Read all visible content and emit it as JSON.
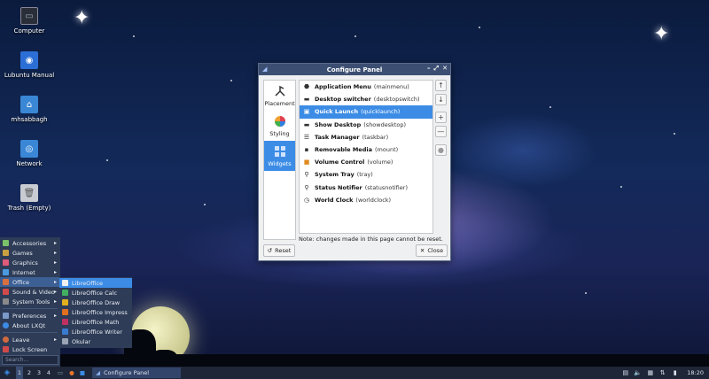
{
  "desktop_icons": [
    {
      "label": "Computer",
      "icon": "computer-icon"
    },
    {
      "label": "Lubuntu Manual",
      "icon": "manual-icon"
    },
    {
      "label": "mhsabbagh",
      "icon": "home-folder-icon"
    },
    {
      "label": "Network",
      "icon": "network-icon"
    },
    {
      "label": "Trash (Empty)",
      "icon": "trash-icon"
    }
  ],
  "dialog": {
    "title": "Configure Panel",
    "sidebar": [
      {
        "label": "Placement",
        "icon": "placement-icon"
      },
      {
        "label": "Styling",
        "icon": "styling-icon"
      },
      {
        "label": "Widgets",
        "icon": "widgets-icon"
      }
    ],
    "widgets": [
      {
        "name": "Application Menu",
        "id": "(mainmenu)",
        "icon": "menu-icon"
      },
      {
        "name": "Desktop switcher",
        "id": "(desktopswitch)",
        "icon": "desktop-switch-icon"
      },
      {
        "name": "Quick Launch",
        "id": "(quicklaunch)",
        "icon": "quicklaunch-icon"
      },
      {
        "name": "Show Desktop",
        "id": "(showdesktop)",
        "icon": "show-desktop-icon"
      },
      {
        "name": "Task Manager",
        "id": "(taskbar)",
        "icon": "taskbar-icon"
      },
      {
        "name": "Removable Media",
        "id": "(mount)",
        "icon": "media-icon"
      },
      {
        "name": "Volume Control",
        "id": "(volume)",
        "icon": "volume-icon"
      },
      {
        "name": "System Tray",
        "id": "(tray)",
        "icon": "tray-icon"
      },
      {
        "name": "Status Notifier",
        "id": "(statusnotifier)",
        "icon": "notifier-icon"
      },
      {
        "name": "World Clock",
        "id": "(worldclock)",
        "icon": "clock-icon"
      }
    ],
    "note": "Note: changes made in this page cannot be reset.",
    "reset_label": "Reset",
    "close_label": "Close",
    "side_buttons": [
      "↑",
      "↓",
      "+",
      "—",
      "●"
    ]
  },
  "start_menu": {
    "items": [
      {
        "label": "Accessories",
        "has_sub": true,
        "color": "#7ac36a"
      },
      {
        "label": "Games",
        "has_sub": true,
        "color": "#c8a040"
      },
      {
        "label": "Graphics",
        "has_sub": true,
        "color": "#e05a7a"
      },
      {
        "label": "Internet",
        "has_sub": true,
        "color": "#4a9ae0"
      },
      {
        "label": "Office",
        "has_sub": true,
        "color": "#d87040"
      },
      {
        "label": "Sound & Video",
        "has_sub": true,
        "color": "#d04a4a"
      },
      {
        "label": "System Tools",
        "has_sub": true,
        "color": "#8a8a8a"
      },
      {
        "label": "Preferences",
        "has_sub": true,
        "color": "#7a9ac8"
      },
      {
        "label": "About LXQt",
        "has_sub": false,
        "color": "#3c8ce6"
      },
      {
        "label": "Leave",
        "has_sub": true,
        "color": "#d06a40"
      },
      {
        "label": "Lock Screen",
        "has_sub": false,
        "color": "#d04a4a"
      }
    ],
    "search_placeholder": "Search..."
  },
  "office_submenu": [
    {
      "label": "LibreOffice",
      "color": "#f0f0f0"
    },
    {
      "label": "LibreOffice Calc",
      "color": "#40b060"
    },
    {
      "label": "LibreOffice Draw",
      "color": "#e0b020"
    },
    {
      "label": "LibreOffice Impress",
      "color": "#e07020"
    },
    {
      "label": "LibreOffice Math",
      "color": "#c03060"
    },
    {
      "label": "LibreOffice Writer",
      "color": "#3a7ad0"
    },
    {
      "label": "Okular",
      "color": "#9aa4b4"
    }
  ],
  "taskbar": {
    "desktops": [
      "1",
      "2",
      "3",
      "4"
    ],
    "active_task": "Configure Panel",
    "clock": "18:20"
  }
}
